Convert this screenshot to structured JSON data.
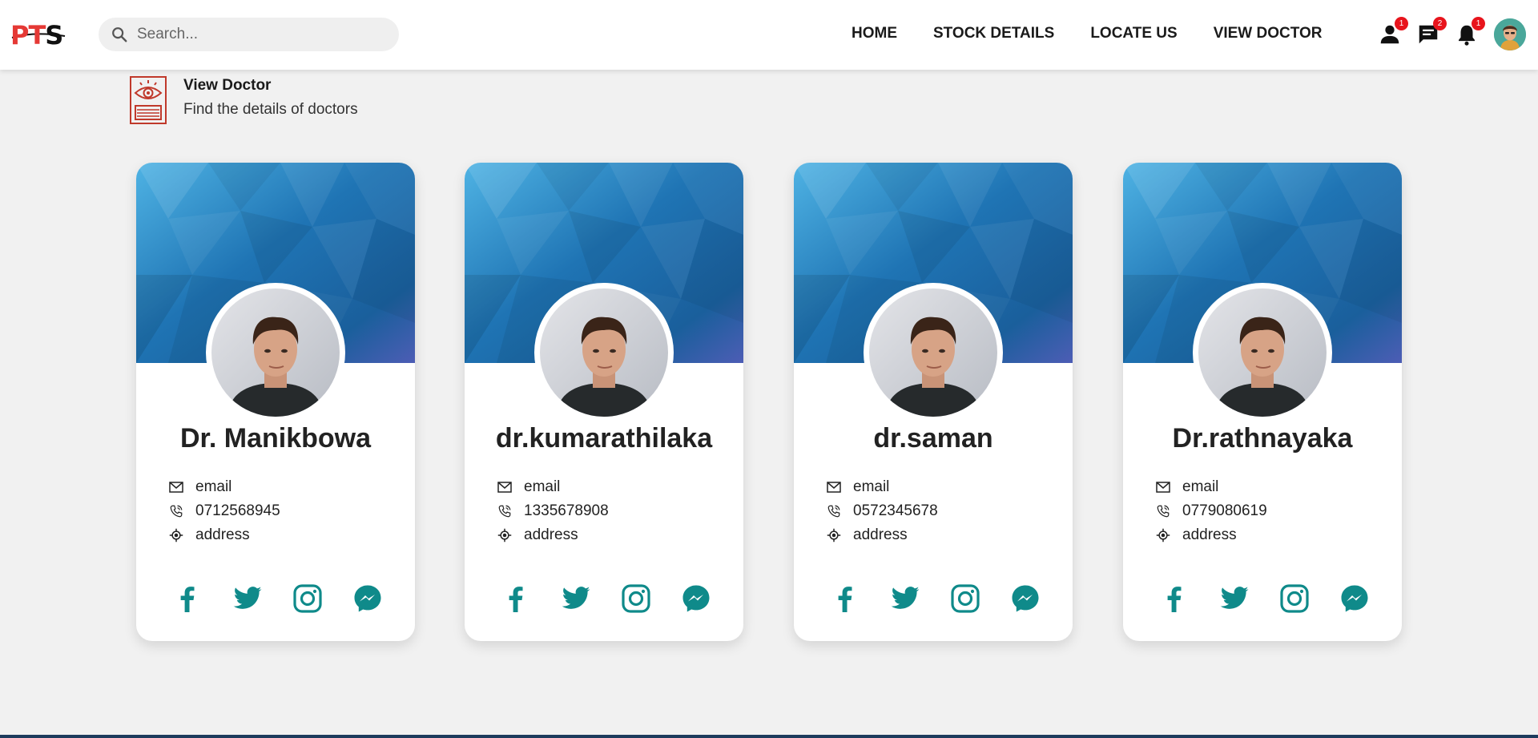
{
  "logo": {
    "text_red": "PT",
    "text_black": "S"
  },
  "search": {
    "placeholder": "Search..."
  },
  "nav": {
    "links": [
      "HOME",
      "STOCK DETAILS",
      "LOCATE US",
      "VIEW DOCTOR"
    ],
    "badges": {
      "user": "1",
      "messages": "2",
      "notifications": "1"
    }
  },
  "page_header": {
    "title": "View Doctor",
    "subtitle": "Find the details of doctors"
  },
  "doctors": [
    {
      "name": "Dr. Manikbowa",
      "email": "email",
      "phone": "0712568945",
      "address": "address"
    },
    {
      "name": "dr.kumarathilaka",
      "email": "email",
      "phone": "1335678908",
      "address": "address"
    },
    {
      "name": "dr.saman",
      "email": "email",
      "phone": "0572345678",
      "address": "address"
    },
    {
      "name": "Dr.rathnayaka",
      "email": "email",
      "phone": "0779080619",
      "address": "address"
    }
  ],
  "colors": {
    "accent_teal": "#0f8a8a",
    "badge_red": "#e8141c",
    "banner_blue": "#1e6aa8",
    "logo_red": "#e53935"
  },
  "icons": [
    "search-icon",
    "user-icon",
    "chat-icon",
    "bell-icon",
    "eye-document-icon",
    "mail-icon",
    "phone-icon",
    "location-icon",
    "facebook-icon",
    "twitter-icon",
    "instagram-icon",
    "messenger-icon"
  ]
}
